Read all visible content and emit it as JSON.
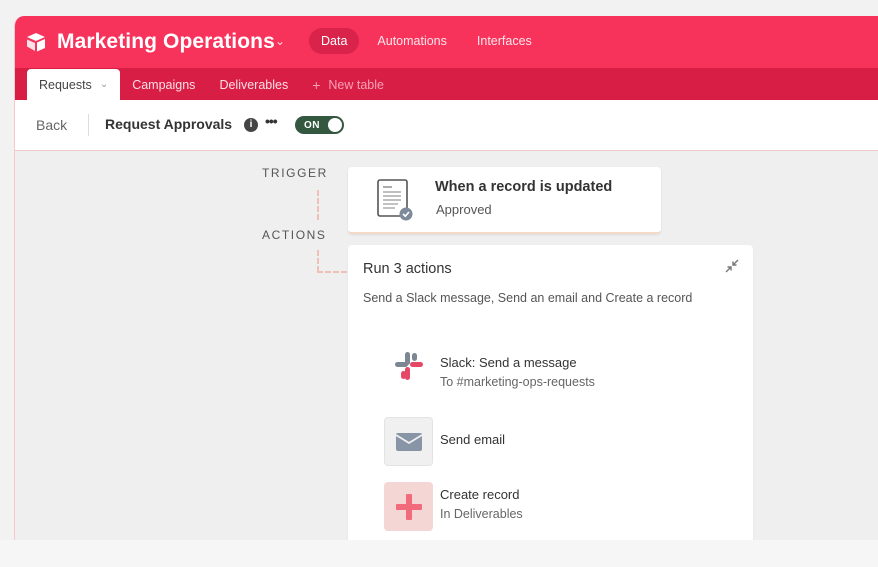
{
  "header": {
    "base_name": "Marketing Operations",
    "nav": [
      {
        "label": "Data",
        "active": true
      },
      {
        "label": "Automations",
        "active": false
      },
      {
        "label": "Interfaces",
        "active": false
      }
    ],
    "logo_icon": "airtable-logo-icon"
  },
  "tabs": [
    {
      "label": "Requests",
      "active": true
    },
    {
      "label": "Campaigns",
      "active": false
    },
    {
      "label": "Deliverables",
      "active": false
    }
  ],
  "new_table_label": "New table",
  "toolbar": {
    "back_label": "Back",
    "automation_name": "Request Approvals",
    "toggle_label": "ON",
    "toggle_on": true
  },
  "flow": {
    "trigger_section": "TRIGGER",
    "actions_section": "ACTIONS",
    "trigger": {
      "title": "When a record is updated",
      "subtitle": "Approved",
      "icon": "document-check-icon"
    },
    "actions_group": {
      "title": "Run 3 actions",
      "description": "Send a Slack message, Send an email and Create a record",
      "items": [
        {
          "title": "Slack: Send a message",
          "subtitle": "To #marketing-ops-requests",
          "icon": "slack-icon"
        },
        {
          "title": "Send email",
          "subtitle": "",
          "icon": "envelope-icon"
        },
        {
          "title": "Create record",
          "subtitle": "In Deliverables",
          "icon": "plus-icon"
        }
      ]
    }
  },
  "colors": {
    "header": "#f7335c",
    "tabsbar": "#d91e45",
    "toggle": "#34573f",
    "create_tint": "#f4d6d4"
  }
}
